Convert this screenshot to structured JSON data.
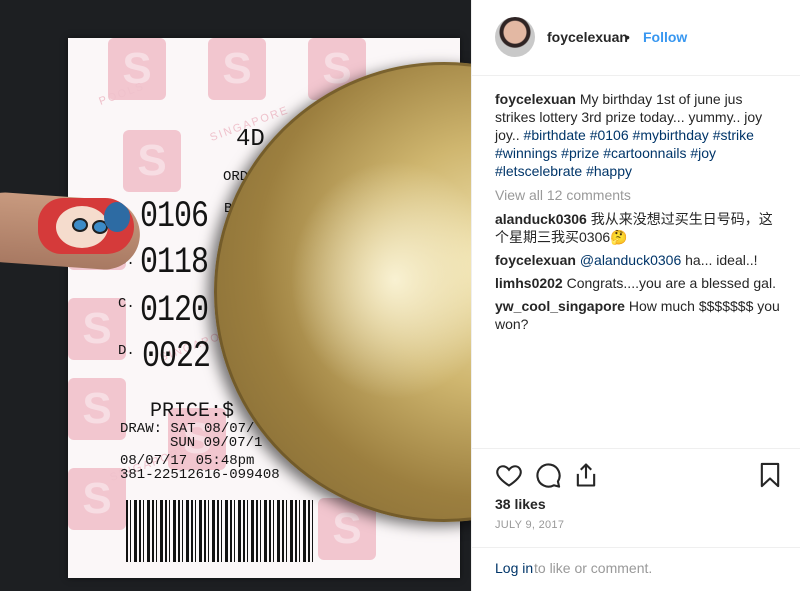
{
  "ticket": {
    "header": "4D",
    "label": "ORDI",
    "side_letter": "B",
    "numbers": [
      "0106",
      "0118",
      "0120",
      "0022"
    ],
    "letters": [
      "B.",
      "C.",
      "D."
    ],
    "price": "PRICE:$",
    "draw1": "DRAW: SAT 08/07/",
    "draw2": "SUN 09/07/1",
    "timestamp": "08/07/17 05:48pm",
    "serial": "381-22512616-099408",
    "watermark": "SINGAPORE",
    "pools": "POOLS"
  },
  "post": {
    "username": "foycelexuan",
    "dot": "•",
    "follow_label": "Follow",
    "caption": {
      "user": "foycelexuan",
      "text": " My birthday 1st of june jus strikes lottery 3rd prize today... yummy.. joy joy.. ",
      "tags": [
        "#birthdate",
        "#0106",
        "#mybirthday",
        "#strike",
        "#winnings",
        "#prize",
        "#cartoonnails",
        "#joy",
        "#letscelebrate",
        "#happy"
      ]
    },
    "view_all": "View all 12 comments",
    "comments": [
      {
        "user": "alanduck0306",
        "text": " 我从来没想过买生日号码，这个星期三我买0306🤔"
      },
      {
        "user": "foycelexuan",
        "mention": "@alanduck0306",
        "text": " ha... ideal..!"
      },
      {
        "user": "limhs0202",
        "text": " Congrats....you are a blessed gal."
      },
      {
        "user": "yw_cool_singapore",
        "text": " How much $$$$$$$ you won?"
      }
    ],
    "likes": "38 likes",
    "date": "JULY 9, 2017",
    "login_label": "Log in",
    "login_rest": "to like or comment."
  },
  "icons": [
    "heart-icon",
    "comment-icon",
    "share-icon",
    "bookmark-icon"
  ]
}
